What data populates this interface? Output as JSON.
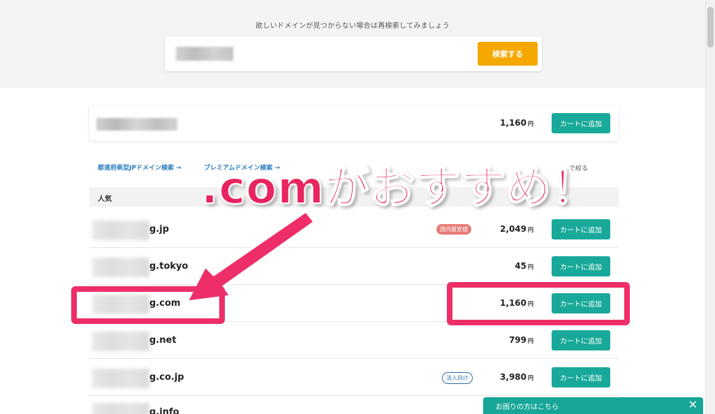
{
  "search": {
    "title": "欲しいドメインが見つからない場合は再検索してみましょう",
    "button_label": "検索する"
  },
  "top_result": {
    "price": "1,160",
    "yen": "円",
    "cart_label": "カートに追加"
  },
  "links": {
    "prefecture": "都道府県型JPドメイン検索 →",
    "premium": "プレミアムドメイン検索 →",
    "filter": "…で絞る"
  },
  "section": {
    "label": "人気"
  },
  "rows": [
    {
      "domain": "g.jp",
      "badge": "国内最安値",
      "badge_type": "red",
      "price": "2,049",
      "yen": "円",
      "cart_label": "カートに追加"
    },
    {
      "domain": "g.tokyo",
      "badge": "",
      "badge_type": "",
      "price": "45",
      "yen": "円",
      "cart_label": "カートに追加"
    },
    {
      "domain": "g.com",
      "badge": "",
      "badge_type": "",
      "price": "1,160",
      "yen": "円",
      "cart_label": "カートに追加"
    },
    {
      "domain": "g.net",
      "badge": "",
      "badge_type": "",
      "price": "799",
      "yen": "円",
      "cart_label": "カートに追加"
    },
    {
      "domain": "g.co.jp",
      "badge": "法人向け",
      "badge_type": "blue",
      "price": "3,980",
      "yen": "円",
      "cart_label": "カートに追加"
    },
    {
      "domain": "g.info",
      "badge": "",
      "badge_type": "",
      "price": "",
      "yen": "",
      "cart_label": ""
    }
  ],
  "annotation": {
    "headline": ".comがおすすめ！",
    "color": "#ee2e69"
  },
  "help": {
    "label": "お困りの方はこちら",
    "close_glyph": "✕"
  }
}
